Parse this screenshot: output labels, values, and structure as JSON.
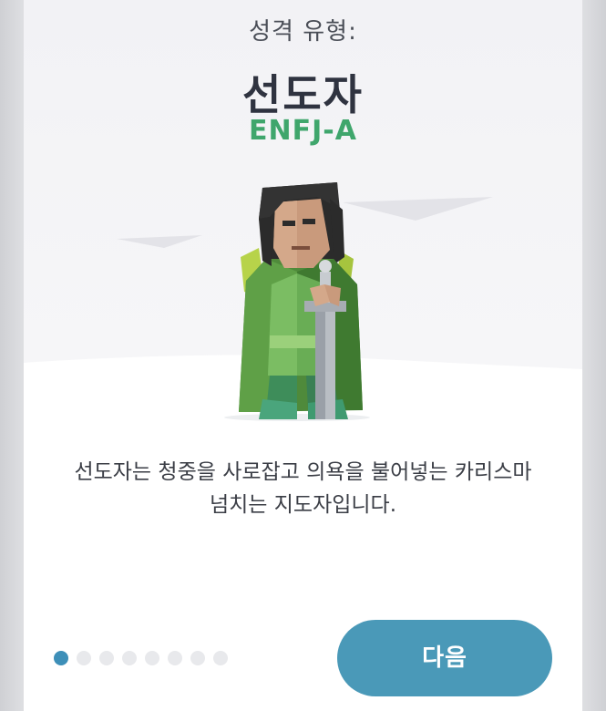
{
  "header": {
    "label": "성격 유형:",
    "type_name": "선도자",
    "type_code": "ENFJ-A"
  },
  "illustration": {
    "icon": "sword-character-illustration",
    "accent_green": "#3fa66c"
  },
  "description": {
    "line1": "선도자는 청중을 사로잡고 의욕을 불어넣는 카리스마",
    "line2": "넘치는 지도자입니다."
  },
  "pagination": {
    "total": 8,
    "current": 1
  },
  "footer": {
    "next_label": "다음",
    "button_color": "#4a99b8"
  }
}
